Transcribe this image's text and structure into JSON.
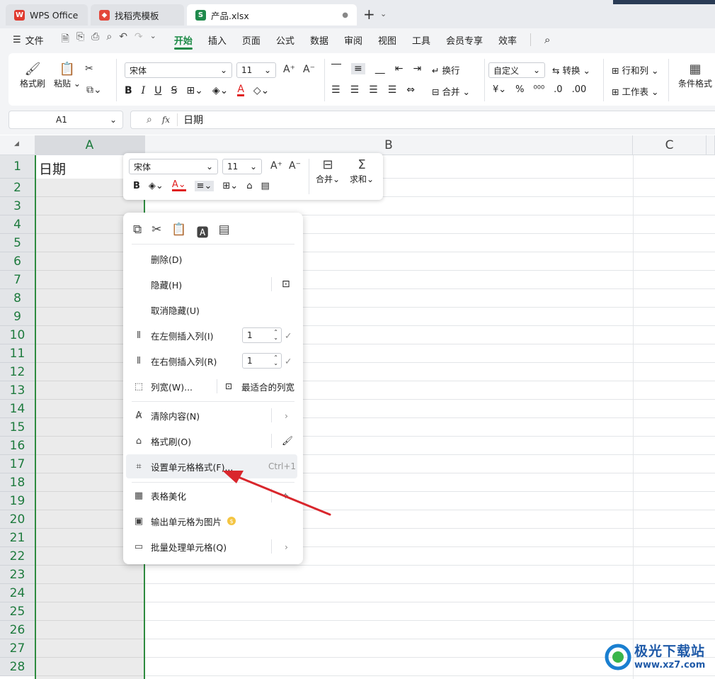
{
  "tabs": [
    {
      "label": "WPS Office",
      "icon": "wps-logo-icon"
    },
    {
      "label": "找稻壳模板",
      "icon": "daoke-icon"
    },
    {
      "label": "产品.xlsx",
      "icon": "sheet-icon"
    }
  ],
  "new_tab": "+",
  "menu": [
    "文件",
    "开始",
    "插入",
    "页面",
    "公式",
    "数据",
    "审阅",
    "视图",
    "工具",
    "会员专享",
    "效率"
  ],
  "active_menu": "开始",
  "ribbon": {
    "format_painter": "格式刷",
    "paste": "粘贴",
    "font_name": "宋体",
    "font_size": "11",
    "number_format": "自定义",
    "wrap": "换行",
    "merge": "合并",
    "convert": "转换",
    "rows_cols": "行和列",
    "worksheet": "工作表",
    "cond_format": "条件格式"
  },
  "formula": {
    "cell_ref": "A1",
    "fx": "fx",
    "value": "日期"
  },
  "columns": [
    "A",
    "B",
    "C"
  ],
  "rows": [
    "1",
    "2",
    "3",
    "4",
    "5",
    "6",
    "7",
    "8",
    "9",
    "10",
    "11",
    "12",
    "13",
    "14",
    "15",
    "16",
    "17",
    "18",
    "19",
    "20",
    "21",
    "22",
    "23",
    "24",
    "25",
    "26",
    "27",
    "28"
  ],
  "cell_a1": "日期",
  "minibar": {
    "font_name": "宋体",
    "font_size": "11",
    "merge": "合并",
    "sum": "求和"
  },
  "context_menu": {
    "delete": "删除(D)",
    "hide": "隐藏(H)",
    "unhide": "取消隐藏(U)",
    "insert_left": "在左侧插入列(I)",
    "insert_left_value": "1",
    "insert_right": "在右侧插入列(R)",
    "insert_right_value": "1",
    "col_width": "列宽(W)...",
    "best_fit": "最适合的列宽",
    "clear": "清除内容(N)",
    "format_painter": "格式刷(O)",
    "format_cells": "设置单元格格式(F)...",
    "format_cells_shortcut": "Ctrl+1",
    "beautify": "表格美化",
    "export_image": "输出单元格为图片",
    "batch": "批量处理单元格(Q)"
  },
  "watermark": {
    "brand": "极光下载站",
    "url": "www.xz7.com"
  },
  "colors": {
    "accent": "#1d8a47",
    "arrow": "#d9262c",
    "font_red": "#e02020"
  }
}
